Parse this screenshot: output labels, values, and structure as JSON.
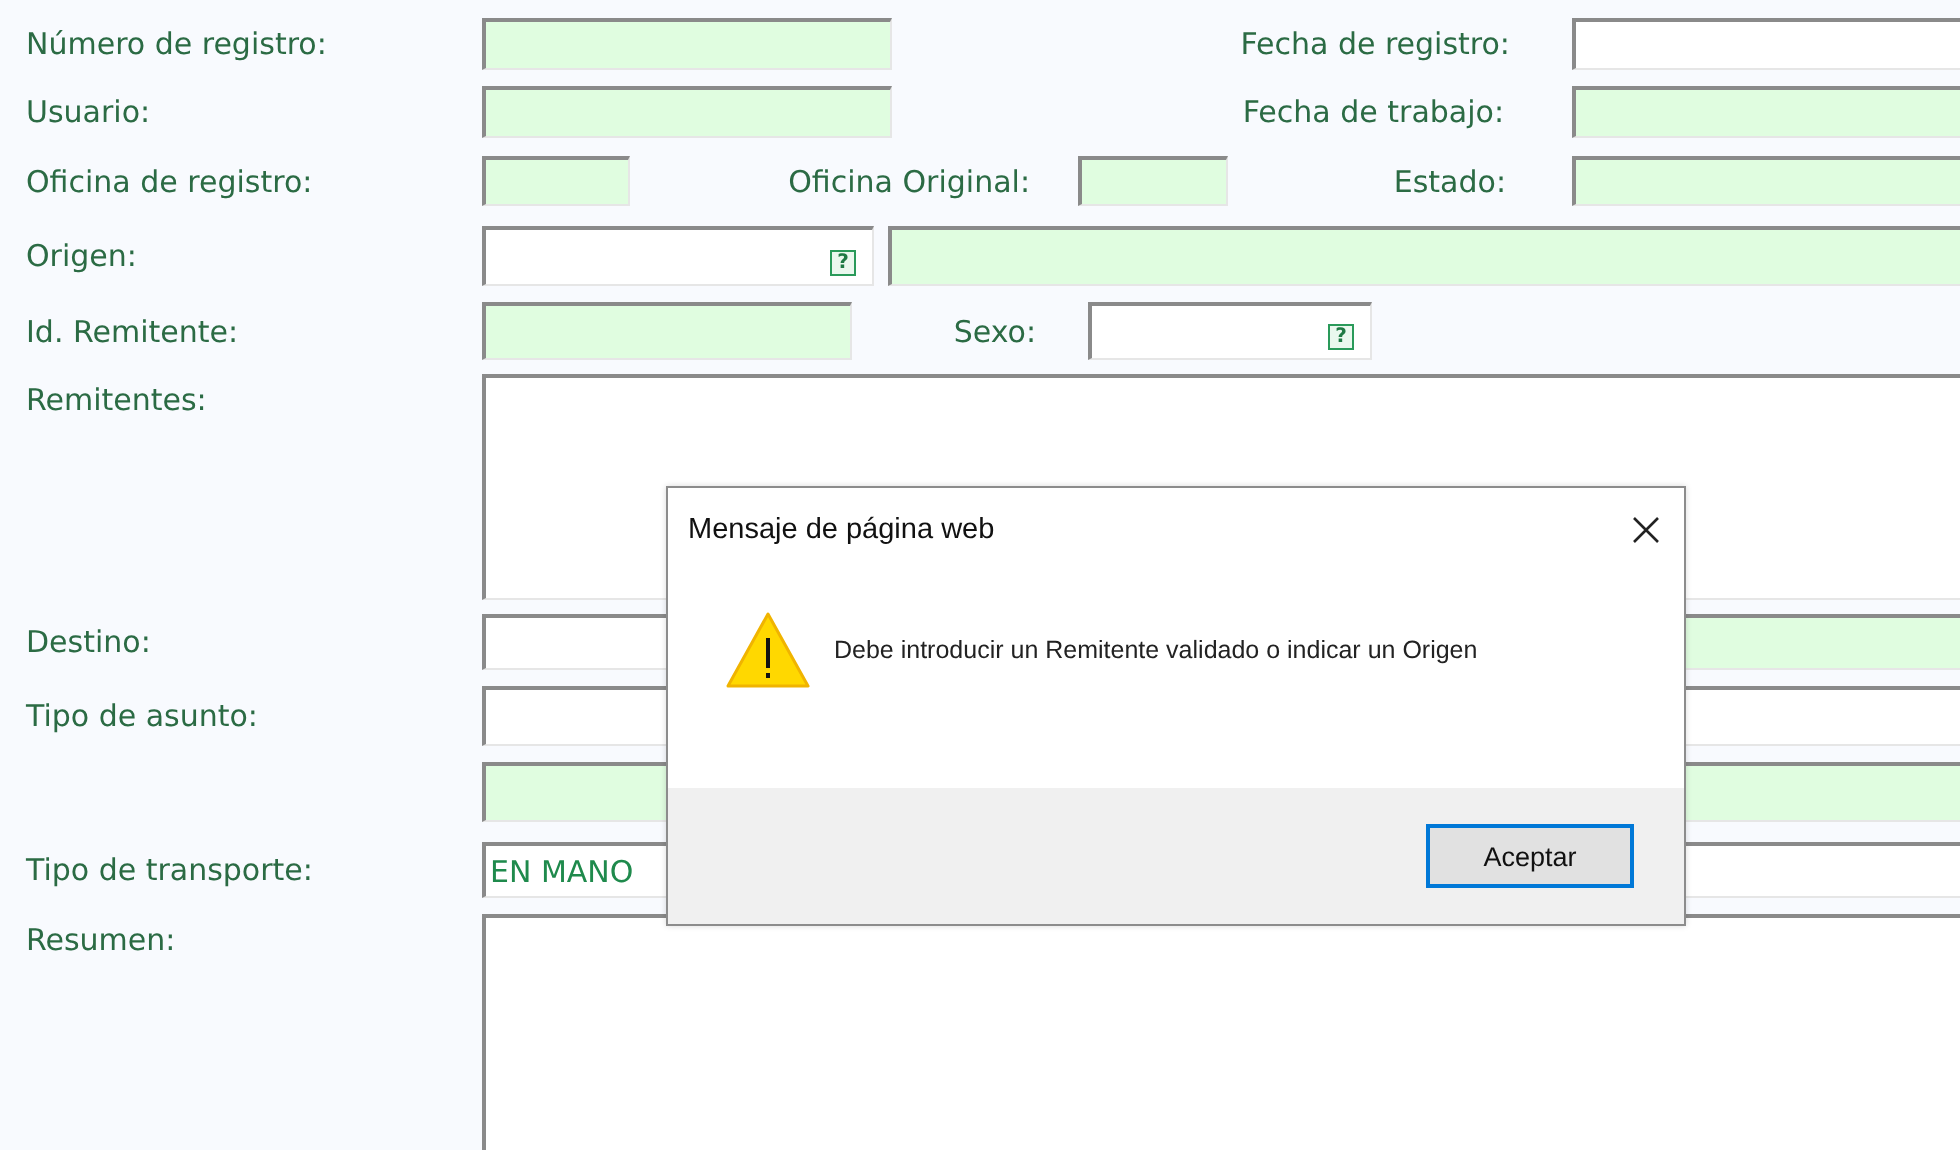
{
  "form": {
    "rows": [
      {
        "items": [
          {
            "kind": "label",
            "text": "Número de registro:"
          },
          {
            "kind": "field",
            "disabled": true
          },
          {
            "kind": "label",
            "text": "Fecha de registro:"
          },
          {
            "kind": "field",
            "disabled": false
          }
        ]
      },
      {
        "items": [
          {
            "kind": "label",
            "text": "Usuario:"
          },
          {
            "kind": "field",
            "disabled": true
          },
          {
            "kind": "label",
            "text": "Fecha de trabajo:"
          },
          {
            "kind": "field",
            "disabled": true
          }
        ]
      },
      {
        "items": [
          {
            "kind": "label",
            "text": "Oficina de registro:"
          },
          {
            "kind": "field",
            "disabled": true
          },
          {
            "kind": "label",
            "text": "Oficina Original:"
          },
          {
            "kind": "field",
            "disabled": true
          },
          {
            "kind": "label",
            "text": "Estado:"
          },
          {
            "kind": "field",
            "disabled": true
          }
        ]
      },
      {
        "items": [
          {
            "kind": "label",
            "text": "Origen:"
          },
          {
            "kind": "field",
            "disabled": false,
            "help": "?"
          },
          {
            "kind": "field",
            "disabled": true
          }
        ]
      },
      {
        "items": [
          {
            "kind": "label",
            "text": "Id. Remitente:"
          },
          {
            "kind": "field",
            "disabled": true
          },
          {
            "kind": "label",
            "text": "Sexo:"
          },
          {
            "kind": "field",
            "disabled": false,
            "help": "?"
          }
        ]
      },
      {
        "items": [
          {
            "kind": "label",
            "text": "Remitentes:"
          },
          {
            "kind": "textarea",
            "disabled": false
          }
        ]
      },
      {
        "items": [
          {
            "kind": "label",
            "text": "Destino:"
          },
          {
            "kind": "field",
            "disabled": false
          },
          {
            "kind": "field",
            "disabled": true
          }
        ]
      },
      {
        "items": [
          {
            "kind": "label",
            "text": "Tipo de asunto:"
          },
          {
            "kind": "field",
            "disabled": false
          }
        ]
      },
      {
        "items": [
          {
            "kind": "field",
            "disabled": true
          }
        ]
      },
      {
        "items": [
          {
            "kind": "label",
            "text": "Tipo de transporte:"
          },
          {
            "kind": "field",
            "disabled": false,
            "value": "EN MANO"
          }
        ]
      },
      {
        "items": [
          {
            "kind": "label",
            "text": "Resumen:"
          },
          {
            "kind": "textarea",
            "disabled": false
          }
        ]
      }
    ]
  },
  "dialog": {
    "title": "Mensaje de página web",
    "message": "Debe introducir un Remitente validado o indicar un Origen",
    "buttons": [
      "Aceptar"
    ]
  }
}
